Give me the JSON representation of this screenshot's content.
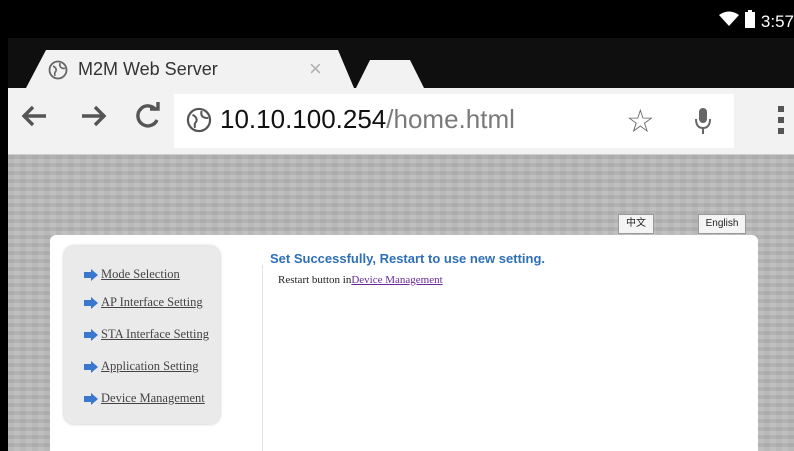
{
  "status_bar": {
    "time": "3:57",
    "icons": [
      "wifi-icon",
      "battery-icon"
    ]
  },
  "browser": {
    "tab": {
      "title": "M2M Web Server",
      "close_glyph": "×"
    },
    "url": {
      "host": "10.10.100.254",
      "path": "/home.html"
    },
    "colors": {
      "tab_bg": "#f2f2f2",
      "tabstrip_bg": "#0f0f0f"
    }
  },
  "page": {
    "lang_buttons": {
      "zh": "中文",
      "en": "English"
    },
    "sidebar": {
      "items": [
        {
          "label": "Mode Selection"
        },
        {
          "label": "AP Interface Setting"
        },
        {
          "label": "STA Interface Setting"
        },
        {
          "label": "Application Setting"
        },
        {
          "label": "Device Management"
        }
      ]
    },
    "main": {
      "title": "Set Successfully, Restart to use new setting.",
      "line_prefix": "Restart button in",
      "line_link": "Device Management"
    },
    "colors": {
      "title": "#2e6fb8",
      "link": "#6a2a9a",
      "arrow": "#3a78d0"
    }
  }
}
